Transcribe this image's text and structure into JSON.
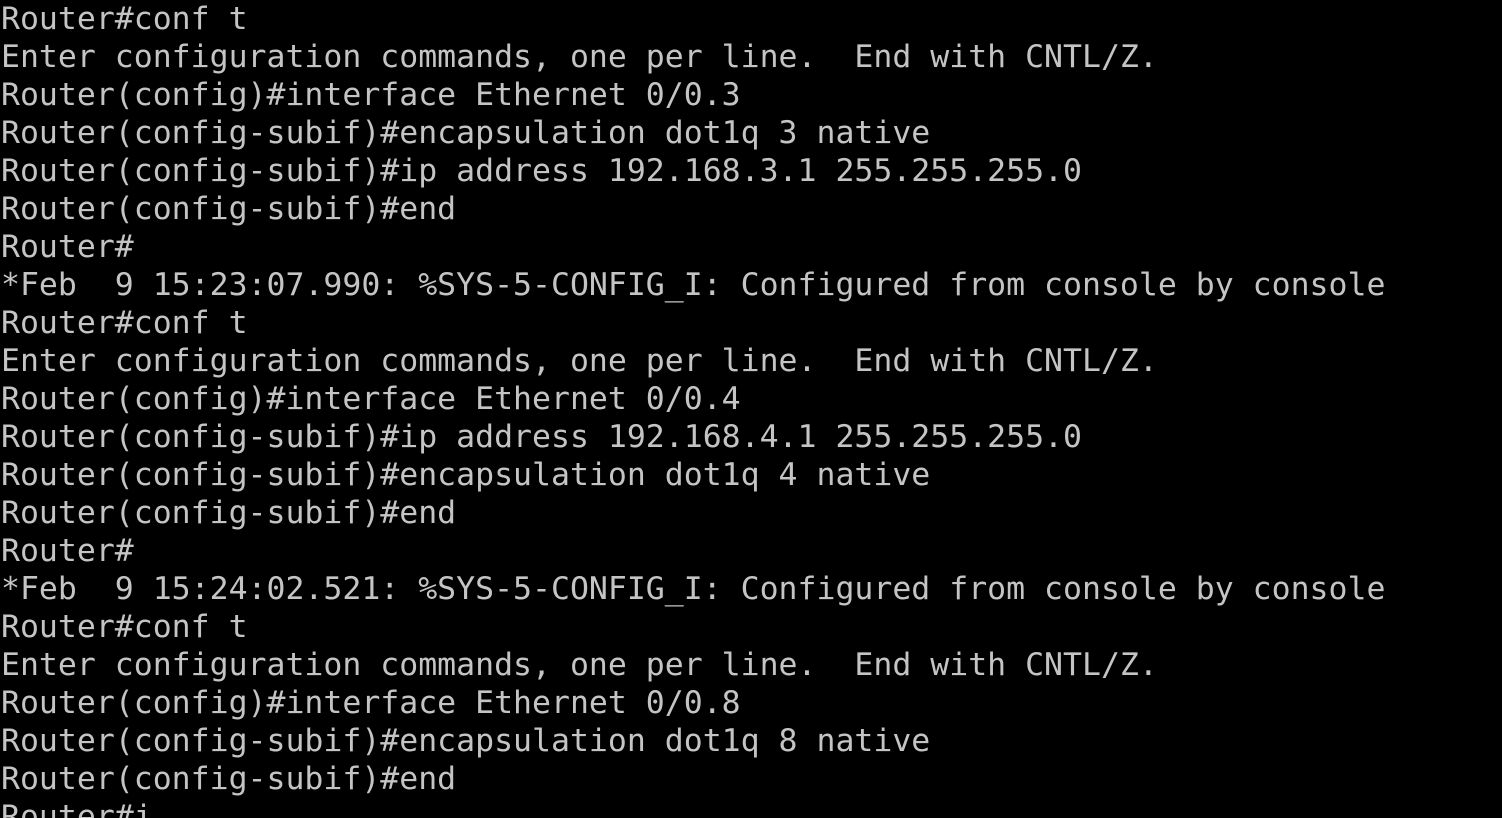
{
  "terminal": {
    "foreground": "#c4c4c4",
    "background": "#000000",
    "lines": [
      "Router#conf t",
      "Enter configuration commands, one per line.  End with CNTL/Z.",
      "Router(config)#interface Ethernet 0/0.3",
      "Router(config-subif)#encapsulation dot1q 3 native",
      "Router(config-subif)#ip address 192.168.3.1 255.255.255.0",
      "Router(config-subif)#end",
      "Router#",
      "*Feb  9 15:23:07.990: %SYS-5-CONFIG_I: Configured from console by console",
      "Router#conf t",
      "Enter configuration commands, one per line.  End with CNTL/Z.",
      "Router(config)#interface Ethernet 0/0.4",
      "Router(config-subif)#ip address 192.168.4.1 255.255.255.0",
      "Router(config-subif)#encapsulation dot1q 4 native",
      "Router(config-subif)#end",
      "Router#",
      "*Feb  9 15:24:02.521: %SYS-5-CONFIG_I: Configured from console by console",
      "Router#conf t",
      "Enter configuration commands, one per line.  End with CNTL/Z.",
      "Router(config)#interface Ethernet 0/0.8",
      "Router(config-subif)#encapsulation dot1q 8 native",
      "Router(config-subif)#end",
      "Router#i"
    ]
  }
}
